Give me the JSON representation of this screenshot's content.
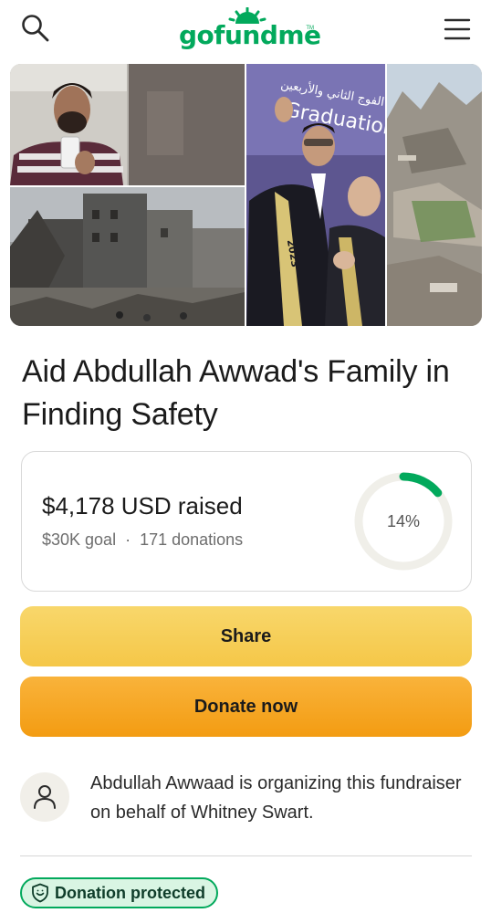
{
  "header": {
    "logo_text": "gofundme",
    "logo_tm": "TM",
    "brand_color": "#02a95c",
    "search_icon": "search-icon",
    "menu_icon": "hamburger-menu-icon"
  },
  "campaign": {
    "title": "Aid Abdullah Awwad's Family in Finding Safety",
    "photos": [
      "selfie-photo",
      "rubble-photo",
      "graduation-photo",
      "destroyed-buildings-photo"
    ],
    "graduation_sign": "Graduation",
    "graduation_arabic": "الفوج الثاني والأربعين",
    "sash_year": "2023"
  },
  "stats": {
    "raised": "$4,178 USD raised",
    "goal": "$30K goal",
    "separator": "·",
    "donations": "171 donations",
    "progress_label": "14%",
    "progress": 0.14
  },
  "actions": {
    "share_label": "Share",
    "donate_label": "Donate now"
  },
  "organizer": {
    "text": "Abdullah Awwaad is organizing this fundraiser on behalf of Whitney Swart."
  },
  "badge": {
    "label": "Donation protected",
    "icon": "shield-icon"
  }
}
